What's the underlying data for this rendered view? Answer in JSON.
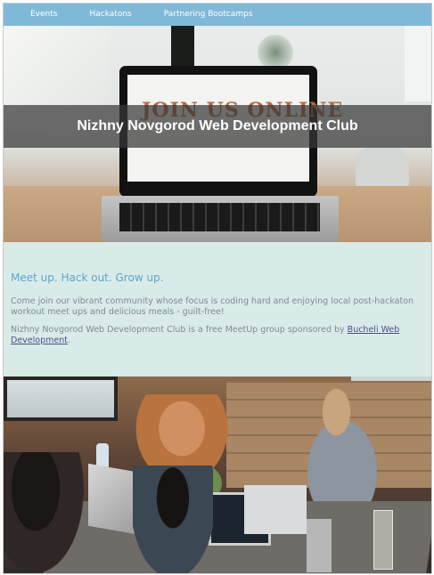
{
  "nav": {
    "items": [
      "Events",
      "Hackatons",
      "Partnering Bootcamps"
    ]
  },
  "hero": {
    "title": "Nizhny Novgorod Web Development Club",
    "screen_text": "JOIN US ONLINE"
  },
  "intro": {
    "heading": "Meet up. Hack out. Grow up.",
    "paragraph1": "Come join our vibrant community whose focus is coding hard and enjoying local post-hackaton workout meet ups and delicious meals - guilt-free!",
    "paragraph2_prefix": "Nizhny Novgorod Web Development Club is a free MeetUp group sponsored by ",
    "sponsor_link": "Bucheli Web Development",
    "paragraph2_suffix": "."
  },
  "colors": {
    "nav_bg": "#80b9d8",
    "intro_bg": "#d8ebe8",
    "heading": "#5ba6cf",
    "body_text": "#7e8b92",
    "link": "#4b4f86"
  }
}
